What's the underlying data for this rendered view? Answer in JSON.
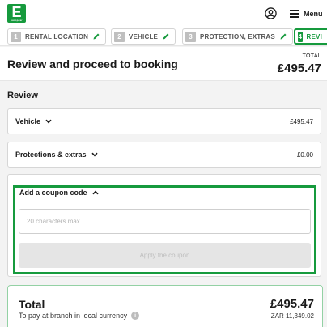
{
  "header": {
    "logo_text": "E",
    "logo_small": "europcar",
    "menu_label": "Menu",
    "icons": {
      "account": "account-icon",
      "menu": "hamburger-menu-icon"
    }
  },
  "steps": [
    {
      "num": "1",
      "label": "RENTAL LOCATION"
    },
    {
      "num": "2",
      "label": "VEHICLE"
    },
    {
      "num": "3",
      "label": "PROTECTION, EXTRAS"
    },
    {
      "num": "4",
      "label": "REVI"
    }
  ],
  "page": {
    "title": "Review and proceed to booking",
    "total_label": "TOTAL",
    "total_amount": "£495.47"
  },
  "review": {
    "section_title": "Review",
    "vehicle_label": "Vehicle",
    "vehicle_amount": "£495.47",
    "protections_label": "Protections & extras",
    "protections_amount": "£0.00"
  },
  "coupon": {
    "title": "Add a coupon code",
    "placeholder": "20 characters max.",
    "value": "",
    "apply_label": "Apply the coupon"
  },
  "total": {
    "label": "Total",
    "note": "To pay at branch in local currency",
    "amount": "£495.47",
    "local_amount": "ZAR 11,349.02",
    "info_glyph": "i"
  },
  "colors": {
    "brand_green": "#169a3d",
    "disabled_button": "#e5e5e5",
    "total_border": "#93d1a4"
  }
}
